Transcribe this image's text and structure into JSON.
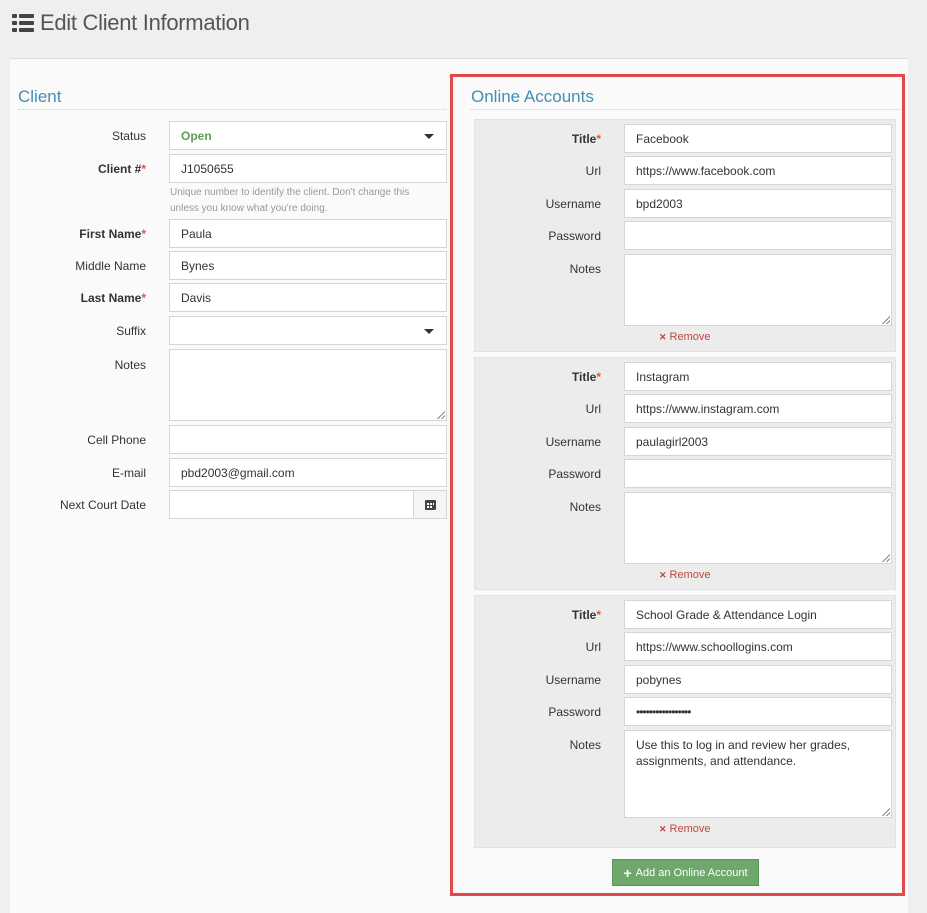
{
  "header": {
    "title": "Edit Client Information",
    "icon": "list-icon"
  },
  "client": {
    "section_title": "Client",
    "status": {
      "label": "Status",
      "value": "Open"
    },
    "client_no": {
      "label": "Client #",
      "value": "J1050655",
      "help": "Unique number to identify the client. Don't change this unless you know what you're doing."
    },
    "first_name": {
      "label": "First Name",
      "value": "Paula"
    },
    "middle_name": {
      "label": "Middle Name",
      "value": "Bynes"
    },
    "last_name": {
      "label": "Last Name",
      "value": "Davis"
    },
    "suffix": {
      "label": "Suffix",
      "value": ""
    },
    "notes": {
      "label": "Notes",
      "value": ""
    },
    "cell_phone": {
      "label": "Cell Phone",
      "value": ""
    },
    "email": {
      "label": "E-mail",
      "value": "pbd2003@gmail.com"
    },
    "next_court_date": {
      "label": "Next Court Date",
      "value": ""
    }
  },
  "online_accounts": {
    "section_title": "Online Accounts",
    "labels": {
      "title": "Title",
      "url": "Url",
      "username": "Username",
      "password": "Password",
      "notes": "Notes",
      "remove": "Remove"
    },
    "accounts": [
      {
        "title": "Facebook",
        "url": "https://www.facebook.com",
        "username": "bpd2003",
        "password": "",
        "notes": ""
      },
      {
        "title": "Instagram",
        "url": "https://www.instagram.com",
        "username": "paulagirl2003",
        "password": "",
        "notes": ""
      },
      {
        "title": "School Grade & Attendance Login",
        "url": "https://www.schoollogins.com",
        "username": "pobynes",
        "password": "•••••••••••••••••",
        "notes": "Use this to log in and review her grades, assignments, and attendance."
      }
    ],
    "add_button": "Add an Online Account"
  },
  "colors": {
    "accent": "#438eb9",
    "required": "#d15b47",
    "status_open": "#629b58",
    "highlight": "#e04a4a",
    "button": "#6fa86b"
  }
}
